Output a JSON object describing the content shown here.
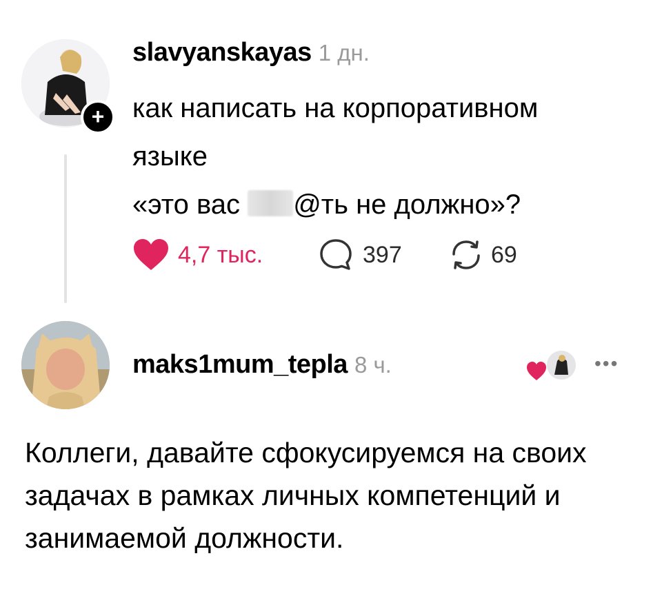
{
  "post": {
    "username": "slavyanskayas",
    "time": "1 дн.",
    "text_line1": "как написать на корпоративном",
    "text_line2": "языке",
    "text_line3_a": "«это вас",
    "text_line3_b": "@ть не должно»?",
    "likes": "4,7 тыс.",
    "comments": "397",
    "reposts": "69",
    "follow_symbol": "+"
  },
  "reply": {
    "username": "maks1mum_tepla",
    "time": "8 ч.",
    "text": "Коллеги, давайте сфокусируемся на своих задачах в рамках личных компетенций и занимаемой должности.",
    "more": "•••"
  },
  "icons": {
    "heart": "heart-icon",
    "comment": "comment-icon",
    "repost": "repost-icon",
    "liked_by_author": "author-liked-icon"
  },
  "colors": {
    "like": "#e0245e",
    "time": "#9a9a9a",
    "thread_line": "#e3e3e3"
  }
}
